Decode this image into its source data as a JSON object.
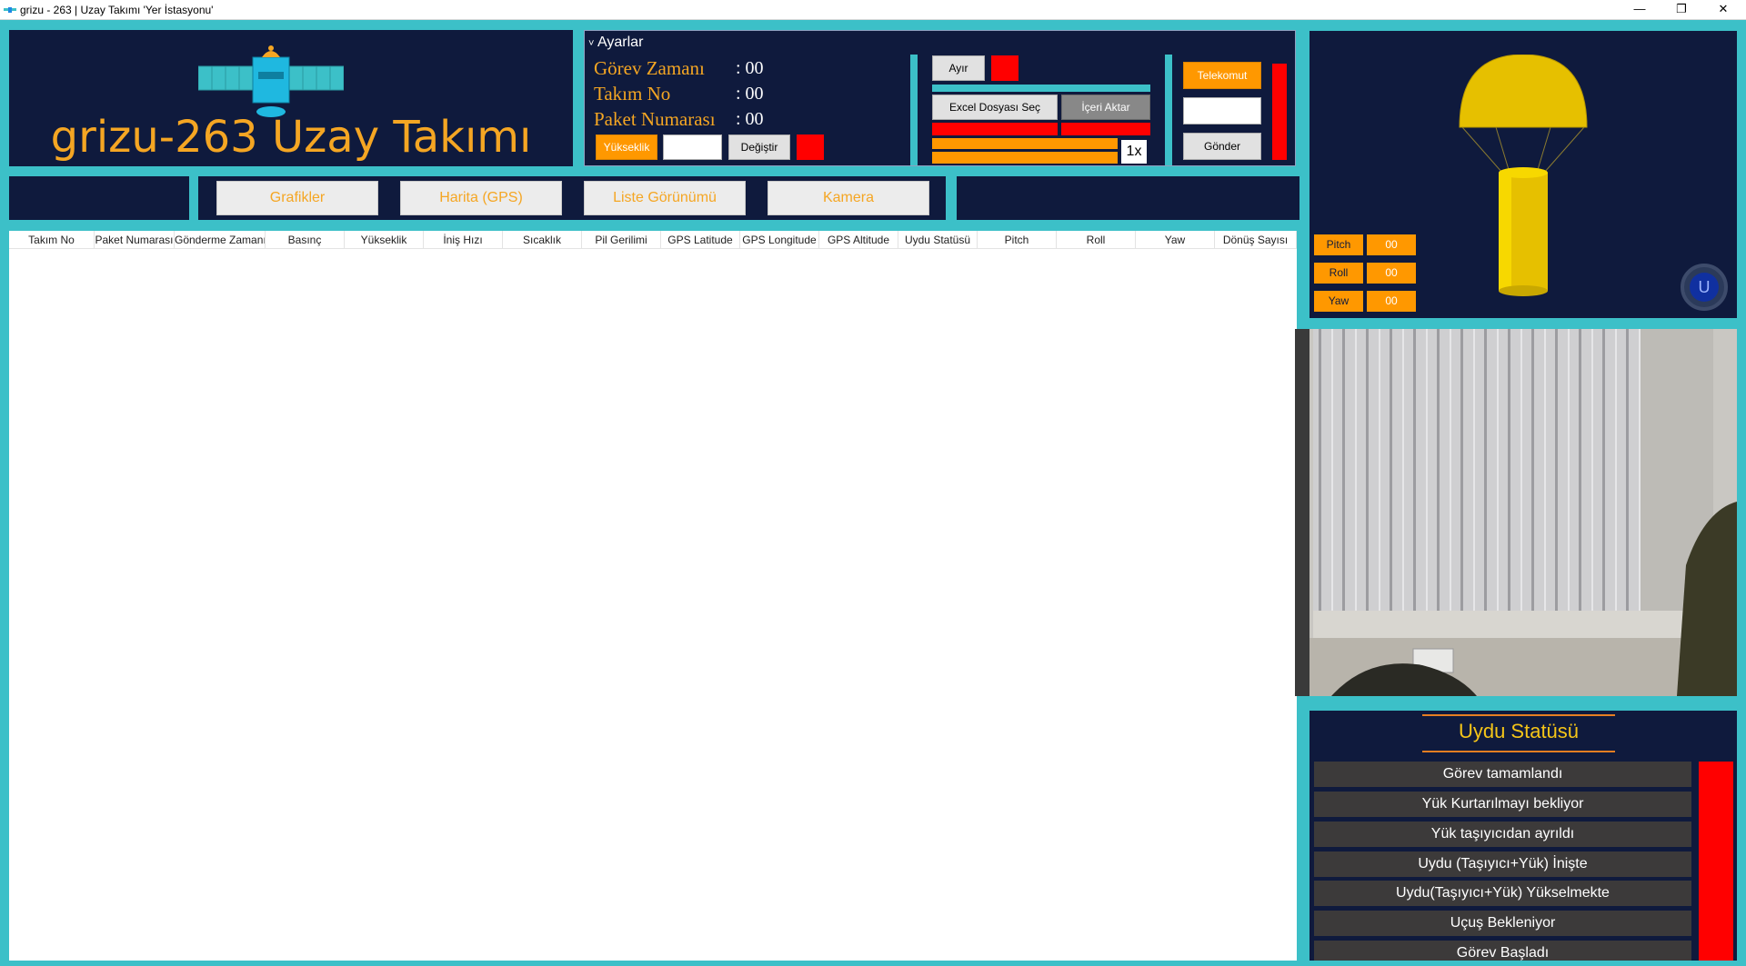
{
  "window": {
    "title": "grizu - 263 | Uzay Takımı  'Yer İstasyonu'",
    "minimize": "—",
    "restore": "❐",
    "close": "✕"
  },
  "header": {
    "team_title": "grizu-263 Uzay Takımı"
  },
  "settings": {
    "expander_label": "Ayarlar",
    "mission_time_label": "Görev Zamanı",
    "mission_time_value": ": 00",
    "team_no_label": "Takım No",
    "team_no_value": ": 00",
    "packet_no_label": "Paket Numarası",
    "packet_no_value": ": 00",
    "altitude_button": "Yükseklik",
    "altitude_input": "",
    "change_button": "Değiştir"
  },
  "controls": {
    "detach_button": "Ayır",
    "excel_button": "Excel Dosyası Seç",
    "import_button": "İçeri Aktar",
    "speed_label": "1x",
    "telecommand_button": "Telekomut",
    "telecommand_input": "",
    "send_button": "Gönder"
  },
  "nav": {
    "tabs": [
      "Grafikler",
      "Harita (GPS)",
      "Liste Görünümü",
      "Kamera"
    ]
  },
  "table": {
    "columns": [
      "Takım No",
      "Paket Numarası",
      "Gönderme Zamanı",
      "Basınç",
      "Yükseklik",
      "İniş Hızı",
      "Sıcaklık",
      "Pil Gerilimi",
      "GPS Latitude",
      "GPS Longitude",
      "GPS Altitude",
      "Uydu Statüsü",
      "Pitch",
      "Roll",
      "Yaw",
      "Dönüş Sayısı"
    ]
  },
  "attitude": {
    "pitch_label": "Pitch",
    "pitch_value": "00",
    "roll_label": "Roll",
    "roll_value": "00",
    "yaw_label": "Yaw",
    "yaw_value": "00",
    "unity_badge": "U"
  },
  "status": {
    "title": "Uydu Statüsü",
    "items": [
      "Görev tamamlandı",
      "Yük Kurtarılmayı bekliyor",
      "Yük taşıyıcıdan ayrıldı",
      "Uydu (Taşıyıcı+Yük) İnişte",
      "Uydu(Taşıyıcı+Yük) Yükselmekte",
      "Uçuş Bekleniyor",
      "Görev Başladı"
    ]
  },
  "colors": {
    "accent": "#f5a623",
    "panel": "#0f1a3d",
    "frame": "#3cc0c8",
    "alert": "#ff0000",
    "button": "#ff9800"
  }
}
